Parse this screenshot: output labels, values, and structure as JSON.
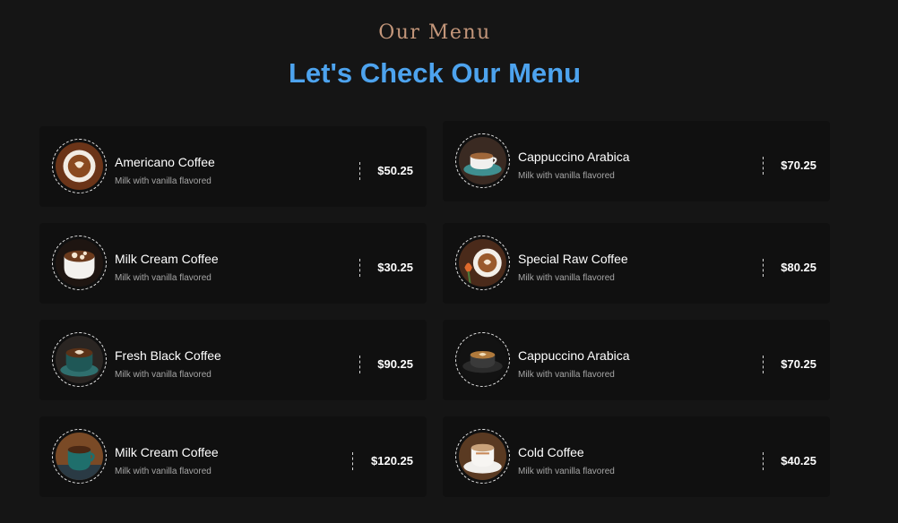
{
  "header": {
    "eyebrow": "Our Menu",
    "title": "Let's Check Our Menu"
  },
  "menu": {
    "items": [
      {
        "name": "Americano Coffee",
        "desc": "Milk with vanilla flavored",
        "price": "$50.25",
        "image": "coffee-latte-art-image"
      },
      {
        "name": "Cappuccino Arabica",
        "desc": "Milk with vanilla flavored",
        "price": "$70.25",
        "image": "coffee-cup-saucer-image"
      },
      {
        "name": "Milk Cream Coffee",
        "desc": "Milk with vanilla flavored",
        "price": "$30.25",
        "image": "coffee-cream-cup-image"
      },
      {
        "name": "Special Raw Coffee",
        "desc": "Milk with vanilla flavored",
        "price": "$80.25",
        "image": "coffee-flower-image"
      },
      {
        "name": "Fresh Black Coffee",
        "desc": "Milk with vanilla flavored",
        "price": "$90.25",
        "image": "coffee-black-cup-image"
      },
      {
        "name": "Cappuccino Arabica",
        "desc": "Milk with vanilla flavored",
        "price": "$70.25",
        "image": "coffee-cup-dark-image"
      },
      {
        "name": "Milk Cream Coffee",
        "desc": "Milk with vanilla flavored",
        "price": "$120.25",
        "image": "coffee-teal-cup-image"
      },
      {
        "name": "Cold Coffee",
        "desc": "Milk with vanilla flavored",
        "price": "$40.25",
        "image": "coffee-white-cup-image"
      }
    ]
  },
  "colors": {
    "background": "#151515",
    "card": "#101010",
    "eyebrow": "#c3967a",
    "title": "#4da3ee"
  }
}
